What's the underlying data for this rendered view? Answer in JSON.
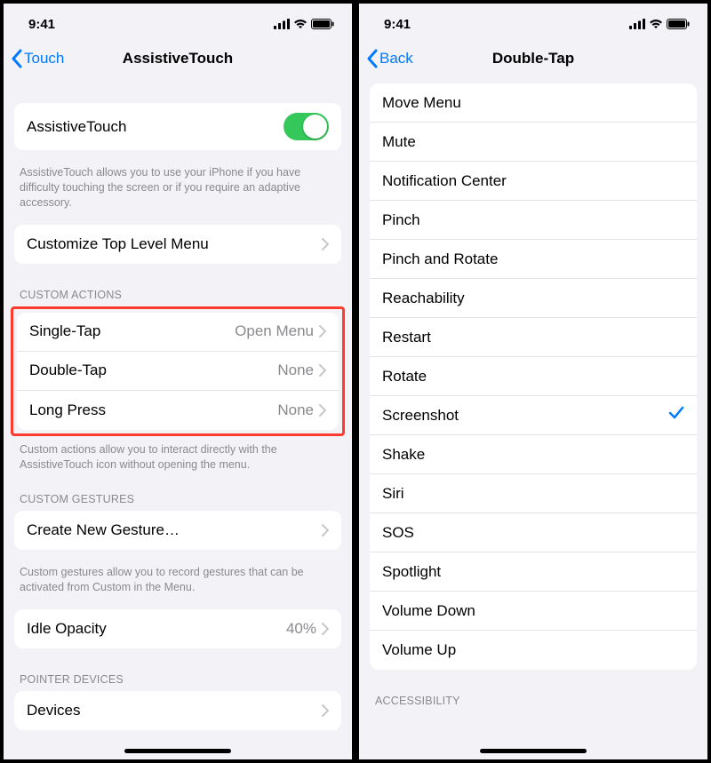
{
  "status": {
    "time": "9:41"
  },
  "left": {
    "back_label": "Touch",
    "title": "AssistiveTouch",
    "toggle": {
      "label": "AssistiveTouch",
      "on": true
    },
    "toggle_footer": "AssistiveTouch allows you to use your iPhone if you have difficulty touching the screen or if you require an adaptive accessory.",
    "customize_label": "Customize Top Level Menu",
    "custom_actions_header": "CUSTOM ACTIONS",
    "actions": [
      {
        "label": "Single-Tap",
        "value": "Open Menu"
      },
      {
        "label": "Double-Tap",
        "value": "None"
      },
      {
        "label": "Long Press",
        "value": "None"
      }
    ],
    "actions_footer": "Custom actions allow you to interact directly with the AssistiveTouch icon without opening the menu.",
    "custom_gestures_header": "CUSTOM GESTURES",
    "create_gesture_label": "Create New Gesture…",
    "gestures_footer": "Custom gestures allow you to record gestures that can be activated from Custom in the Menu.",
    "idle_opacity": {
      "label": "Idle Opacity",
      "value": "40%"
    },
    "pointer_devices_header": "POINTER DEVICES",
    "devices_label": "Devices"
  },
  "right": {
    "back_label": "Back",
    "title": "Double-Tap",
    "options": [
      {
        "label": "Move Menu",
        "selected": false
      },
      {
        "label": "Mute",
        "selected": false
      },
      {
        "label": "Notification Center",
        "selected": false
      },
      {
        "label": "Pinch",
        "selected": false
      },
      {
        "label": "Pinch and Rotate",
        "selected": false
      },
      {
        "label": "Reachability",
        "selected": false
      },
      {
        "label": "Restart",
        "selected": false
      },
      {
        "label": "Rotate",
        "selected": false
      },
      {
        "label": "Screenshot",
        "selected": true
      },
      {
        "label": "Shake",
        "selected": false
      },
      {
        "label": "Siri",
        "selected": false
      },
      {
        "label": "SOS",
        "selected": false
      },
      {
        "label": "Spotlight",
        "selected": false
      },
      {
        "label": "Volume Down",
        "selected": false
      },
      {
        "label": "Volume Up",
        "selected": false
      }
    ],
    "accessibility_header": "ACCESSIBILITY"
  }
}
